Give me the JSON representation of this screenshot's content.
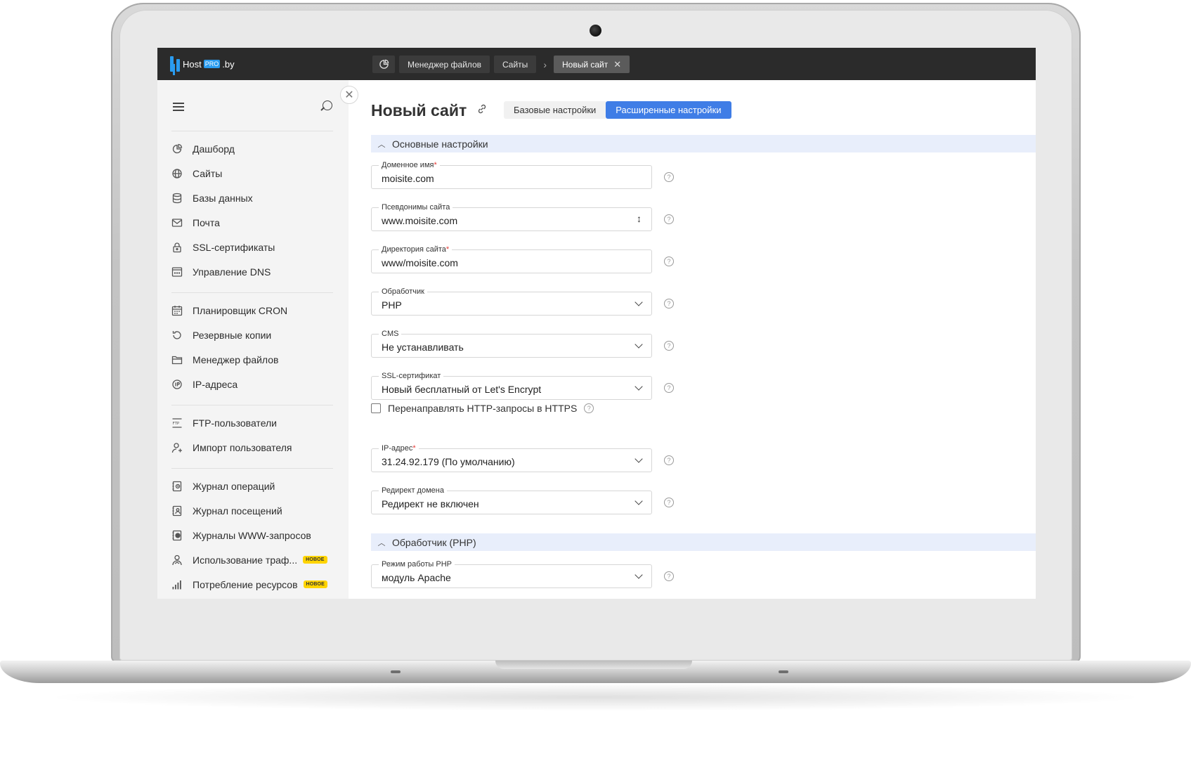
{
  "app": {
    "logo_host": "Host",
    "logo_pro": "PRO",
    "logo_by": ".by"
  },
  "tabs": [
    {
      "label": "Менеджер файлов"
    },
    {
      "label": "Сайты"
    },
    {
      "label": "Новый сайт"
    }
  ],
  "tab_separator": "›",
  "sidebar": {
    "groups": [
      [
        {
          "label": "Дашборд",
          "icon": "dashboard-icon"
        },
        {
          "label": "Сайты",
          "icon": "globe-icon"
        },
        {
          "label": "Базы данных",
          "icon": "database-icon"
        },
        {
          "label": "Почта",
          "icon": "mail-icon"
        },
        {
          "label": "SSL-сертификаты",
          "icon": "lock-icon"
        },
        {
          "label": "Управление DNS",
          "icon": "dns-icon"
        }
      ],
      [
        {
          "label": "Планировщик CRON",
          "icon": "calendar-icon"
        },
        {
          "label": "Резервные копии",
          "icon": "backup-icon"
        },
        {
          "label": "Менеджер файлов",
          "icon": "folder-icon"
        },
        {
          "label": "IP-адреса",
          "icon": "ip-icon"
        }
      ],
      [
        {
          "label": "FTP-пользователи",
          "icon": "ftp-icon"
        },
        {
          "label": "Импорт пользователя",
          "icon": "user-import-icon"
        }
      ],
      [
        {
          "label": "Журнал операций",
          "icon": "log-icon"
        },
        {
          "label": "Журнал посещений",
          "icon": "visits-log-icon"
        },
        {
          "label": "Журналы WWW-запросов",
          "icon": "www-log-icon"
        },
        {
          "label": "Использование траф...",
          "icon": "traffic-icon",
          "badge": "НОВОЕ"
        },
        {
          "label": "Потребление ресурсов",
          "icon": "chart-icon",
          "badge": "НОВОЕ"
        }
      ]
    ]
  },
  "main": {
    "title": "Новый сайт",
    "segments": [
      {
        "label": "Базовые настройки"
      },
      {
        "label": "Расширенные настройки"
      }
    ],
    "section_main": "Основные настройки",
    "section_php": "Обработчик (PHP)",
    "fields": {
      "domain": {
        "label": "Доменное имя",
        "value": "moisite.com"
      },
      "aliases": {
        "label": "Псевдонимы сайта",
        "value": "www.moisite.com"
      },
      "directory": {
        "label": "Директория сайта",
        "value": "www/moisite.com"
      },
      "handler": {
        "label": "Обработчик",
        "value": "PHP"
      },
      "cms": {
        "label": "CMS",
        "value": "Не устанавливать"
      },
      "ssl": {
        "label": "SSL-сертификат",
        "value": "Новый бесплатный от Let's Encrypt"
      },
      "ip": {
        "label": "IP-адрес",
        "value": "31.24.92.179 (По умолчанию)"
      },
      "redirect": {
        "label": "Редирект домена",
        "value": "Редирект не включен"
      },
      "php_mode": {
        "label": "Режим работы PHP",
        "value": "модуль Apache"
      }
    },
    "https_redirect_label": "Перенаправлять HTTP-запросы в HTTPS",
    "required_mark": "*",
    "help_glyph": "?"
  }
}
